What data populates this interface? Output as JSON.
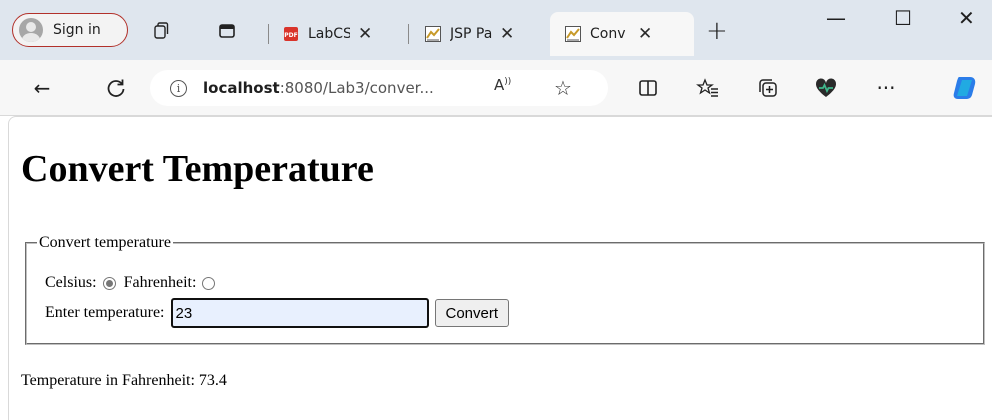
{
  "browser": {
    "sign_in_label": "Sign in",
    "tabs": [
      {
        "title": "LabCS",
        "icon": "pdf-icon"
      },
      {
        "title": "JSP Pa",
        "icon": "java-icon"
      },
      {
        "title": "Conv",
        "icon": "java-icon"
      }
    ],
    "new_tab": "+",
    "window_controls": {
      "minimize": "—",
      "maximize": "☐",
      "close": "✕"
    },
    "address": {
      "host": "localhost",
      "path": ":8080/Lab3/conver..."
    },
    "colors": {
      "tabstrip": "#dfe6ee",
      "toolbar": "#f7f7f7",
      "signin_border": "#b2312a"
    }
  },
  "page": {
    "heading": "Convert Temperature",
    "form": {
      "legend": "Convert temperature",
      "celsius_label": "Celsius:",
      "fahrenheit_label": "Fahrenheit:",
      "selected_unit": "Celsius",
      "temperature_label": "Enter temperature:",
      "temperature_value": "23",
      "submit_label": "Convert"
    },
    "result": "Temperature in Fahrenheit: 73.4"
  }
}
